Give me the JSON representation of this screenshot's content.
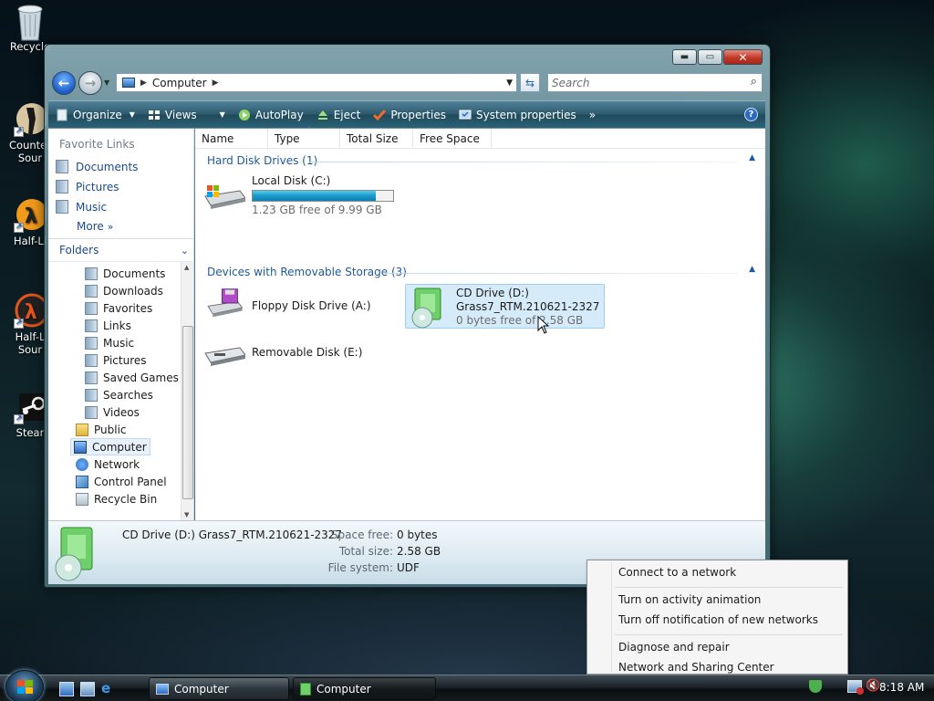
{
  "desktop": {
    "icons": [
      {
        "label": "Recycle"
      },
      {
        "label": "Counter Sour"
      },
      {
        "label": "Half-Li"
      },
      {
        "label": "Half-L Sour"
      },
      {
        "label": "Stear"
      }
    ]
  },
  "window": {
    "address": {
      "crumb": "Computer"
    },
    "search": {
      "placeholder": "Search"
    },
    "toolbar": {
      "organize": "Organize",
      "views": "Views",
      "autoplay": "AutoPlay",
      "eject": "Eject",
      "properties": "Properties",
      "system_properties": "System properties",
      "overflow": "»"
    },
    "favorite_links": {
      "title": "Favorite Links",
      "items": [
        "Documents",
        "Pictures",
        "Music"
      ],
      "more": "More"
    },
    "folders": {
      "title": "Folders",
      "items": [
        "Documents",
        "Downloads",
        "Favorites",
        "Links",
        "Music",
        "Pictures",
        "Saved Games",
        "Searches",
        "Videos",
        "Public",
        "Computer",
        "Network",
        "Control Panel",
        "Recycle Bin"
      ],
      "selected": "Computer"
    },
    "columns": [
      "Name",
      "Type",
      "Total Size",
      "Free Space"
    ],
    "groups": {
      "hdd": "Hard Disk Drives (1)",
      "removable": "Devices with Removable Storage (3)"
    },
    "drives": {
      "c": {
        "name": "Local Disk (C:)",
        "free": "1.23 GB free of 9.99 GB",
        "used_fraction": 0.877
      },
      "a": {
        "name": "Floppy Disk Drive (A:)"
      },
      "d": {
        "name": "CD Drive (D:)",
        "label": "Grass7_RTM.210621-2327",
        "free": "0 bytes free of 2.58 GB"
      },
      "e": {
        "name": "Removable Disk (E:)"
      }
    },
    "details": {
      "title": "CD Drive (D:) Grass7_RTM.210621-2327",
      "space_free_label": "Space free:",
      "space_free": "0 bytes",
      "total_size_label": "Total size:",
      "total_size": "2.58 GB",
      "file_system_label": "File system:",
      "file_system": "UDF"
    }
  },
  "context_menu": {
    "items": [
      "Connect to a network",
      "Turn on activity animation",
      "Turn off notification of new networks",
      "Diagnose and repair",
      "Network and Sharing Center"
    ]
  },
  "taskbar": {
    "buttons": [
      "Computer",
      "Computer"
    ],
    "clock": "8:18 AM"
  },
  "colors": {
    "accent": "#1d5a9a",
    "selection": "#d6ebfa",
    "capacity_bar": "#1b98c8"
  }
}
